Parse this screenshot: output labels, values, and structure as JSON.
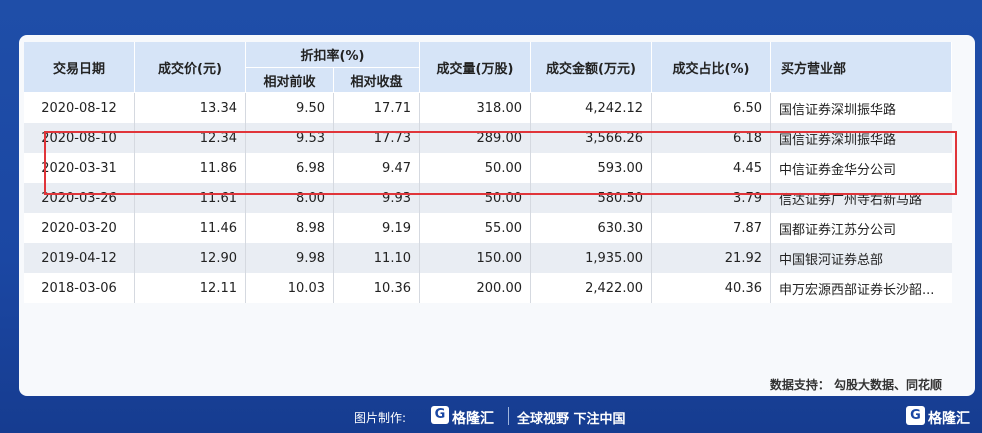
{
  "table": {
    "headers": {
      "date": "交易日期",
      "price": "成交价(元)",
      "discount": "折扣率(%)",
      "disc_prev_close": "相对前收",
      "disc_close": "相对收盘",
      "volume": "成交量(万股)",
      "amount": "成交金额(万元)",
      "ratio": "成交占比(%)",
      "broker": "买方营业部"
    },
    "rows": [
      {
        "date": "2020-08-12",
        "price": "13.34",
        "prev": "9.50",
        "close": "17.71",
        "volume": "318.00",
        "amount": "4,242.12",
        "ratio": "6.50",
        "broker": "国信证券深圳振华路"
      },
      {
        "date": "2020-08-10",
        "price": "12.34",
        "prev": "9.53",
        "close": "17.73",
        "volume": "289.00",
        "amount": "3,566.26",
        "ratio": "6.18",
        "broker": "国信证券深圳振华路"
      },
      {
        "date": "2020-03-31",
        "price": "11.86",
        "prev": "6.98",
        "close": "9.47",
        "volume": "50.00",
        "amount": "593.00",
        "ratio": "4.45",
        "broker": "中信证券金华分公司"
      },
      {
        "date": "2020-03-26",
        "price": "11.61",
        "prev": "8.00",
        "close": "9.93",
        "volume": "50.00",
        "amount": "580.50",
        "ratio": "3.79",
        "broker": "信达证券广州寺右新马路"
      },
      {
        "date": "2020-03-20",
        "price": "11.46",
        "prev": "8.98",
        "close": "9.19",
        "volume": "55.00",
        "amount": "630.30",
        "ratio": "7.87",
        "broker": "国都证券江苏分公司"
      },
      {
        "date": "2019-04-12",
        "price": "12.90",
        "prev": "9.98",
        "close": "11.10",
        "volume": "150.00",
        "amount": "1,935.00",
        "ratio": "21.92",
        "broker": "中国银河证券总部"
      },
      {
        "date": "2018-03-06",
        "price": "12.11",
        "prev": "10.03",
        "close": "10.36",
        "volume": "200.00",
        "amount": "2,422.00",
        "ratio": "40.36",
        "broker": "申万宏源西部证券长沙韶..."
      }
    ]
  },
  "source": "数据支持：  勾股大数据、同花顺",
  "footer": {
    "made_by": "图片制作:",
    "logo_mark": "G",
    "logo_text": "格隆汇",
    "slogan": "全球视野 下注中国"
  },
  "colors": {
    "highlight_border": "#e0353a",
    "header_bg": "#d6e4f7",
    "background": "#1b47a3"
  }
}
